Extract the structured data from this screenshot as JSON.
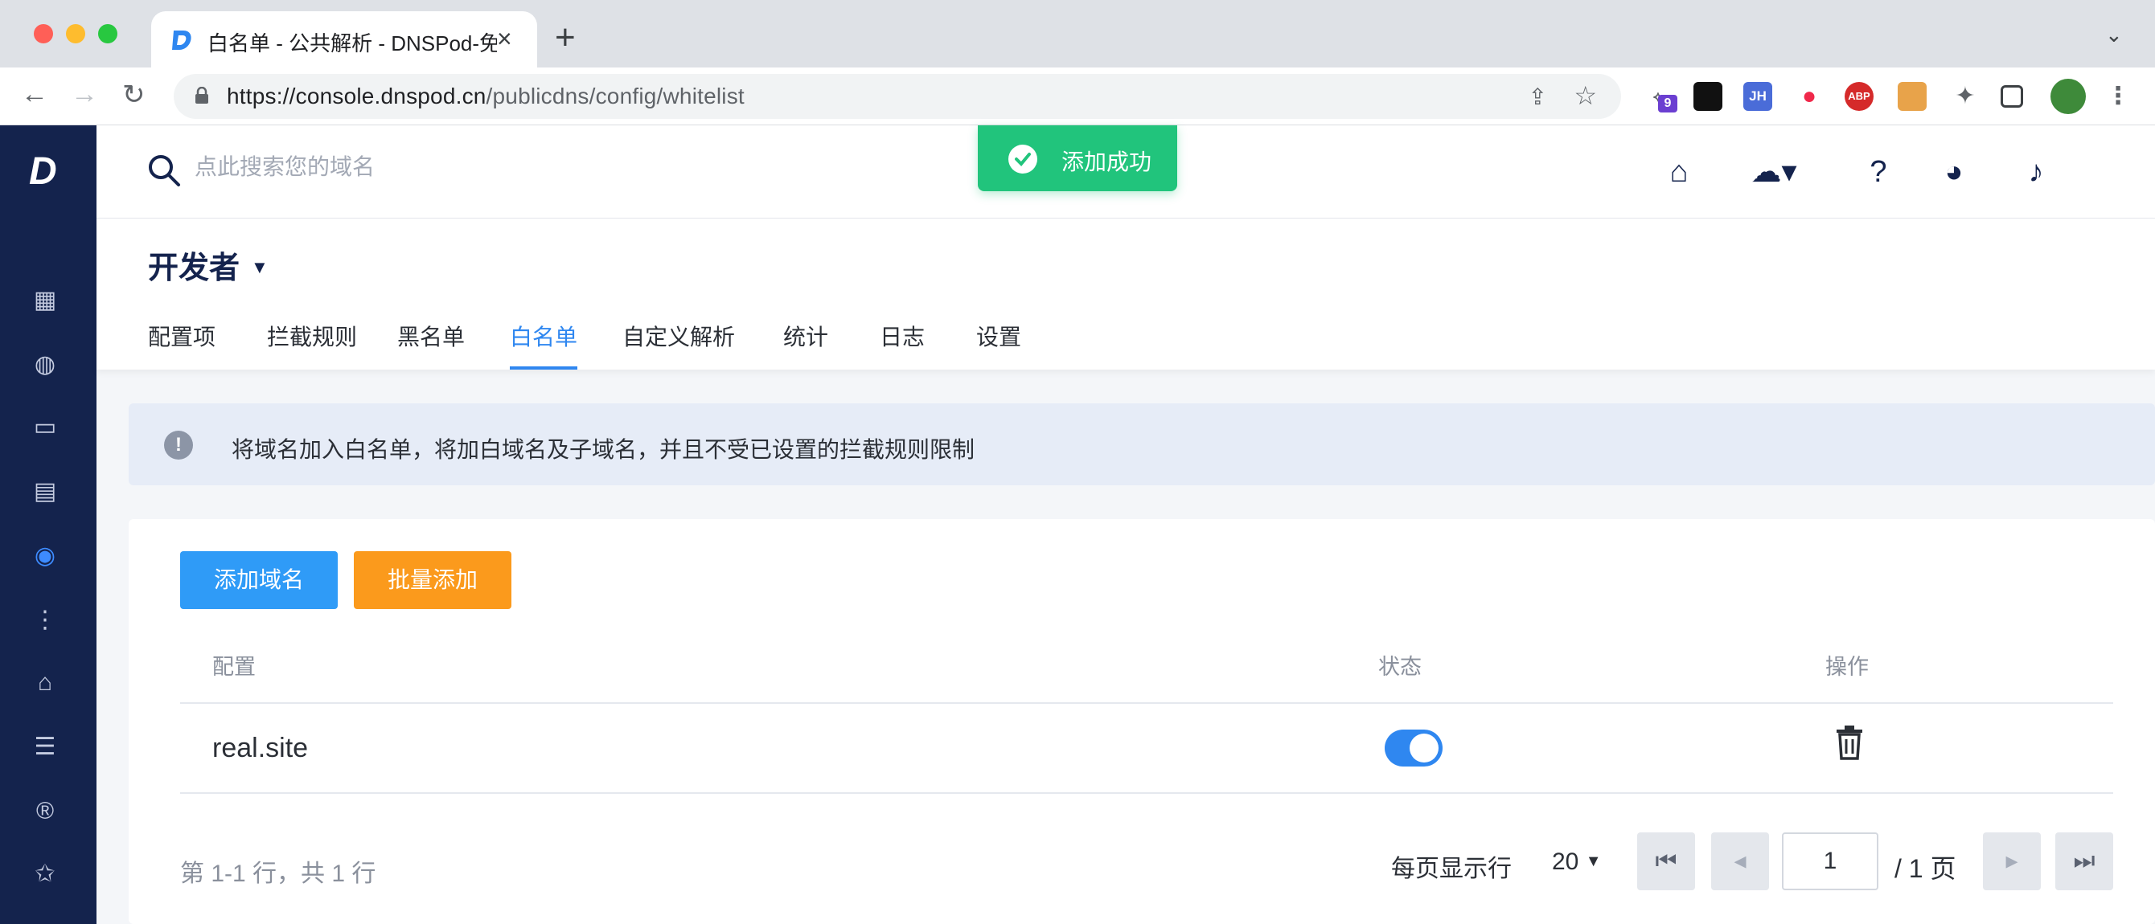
{
  "browser": {
    "tab_title": "白名单 - 公共解析 - DNSPod-免",
    "url_host": "https://console.dnspod.cn",
    "url_path": "/publicdns/config/whitelist",
    "ext_badge": "9",
    "ext_jh": "JH",
    "ext_abp": "ABP"
  },
  "search": {
    "placeholder": "点此搜索您的域名"
  },
  "toast": {
    "message": "添加成功"
  },
  "context": {
    "name": "开发者"
  },
  "tabs": [
    "配置项",
    "拦截规则",
    "黑名单",
    "白名单",
    "自定义解析",
    "统计",
    "日志",
    "设置"
  ],
  "active_tab": "白名单",
  "notice": {
    "text": "将域名加入白名单，将加白域名及子域名，并且不受已设置的拦截规则限制"
  },
  "actions": {
    "add_domain": "添加域名",
    "batch_add": "批量添加"
  },
  "table": {
    "headers": {
      "config": "配置",
      "status": "状态",
      "operation": "操作"
    },
    "rows": [
      {
        "domain": "real.site",
        "enabled": true
      }
    ]
  },
  "pagination": {
    "summary": "第 1-1 行，共 1 行",
    "per_page_label": "每页显示行",
    "per_page_value": "20",
    "current_page": "1",
    "total_pages_label": "/ 1 页"
  },
  "colors": {
    "sidebar": "#14234d",
    "primary": "#2f87f0",
    "warning": "#fb9a1c",
    "success": "#21c47c"
  }
}
